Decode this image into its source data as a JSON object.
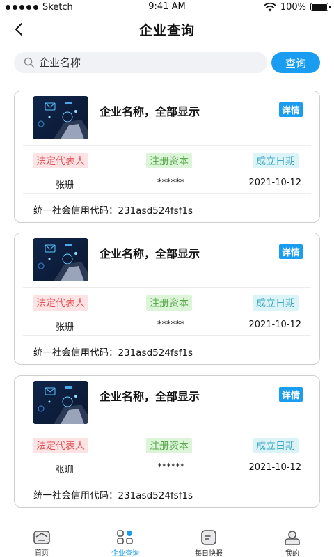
{
  "status_bar": {
    "carrier": "Sketch",
    "time": "9:41 AM",
    "battery": "100%"
  },
  "header": {
    "title": "企业查询"
  },
  "search": {
    "placeholder": "企业名称",
    "button_label": "查询"
  },
  "labels": {
    "legal_rep": "法定代表人",
    "capital": "注册资本",
    "founded": "成立日期",
    "credit_prefix": "统一社会信用代码：",
    "detail": "详情"
  },
  "companies": [
    {
      "name": "企业名称，全部显示",
      "legal_rep": "张珊",
      "capital": "******",
      "founded": "2021-10-12",
      "credit_code": "231asd524fsf1s"
    },
    {
      "name": "企业名称，全部显示",
      "legal_rep": "张珊",
      "capital": "******",
      "founded": "2021-10-12",
      "credit_code": "231asd524fsf1s"
    },
    {
      "name": "企业名称，全部显示",
      "legal_rep": "张珊",
      "capital": "******",
      "founded": "2021-10-12",
      "credit_code": "231asd524fsf1s"
    }
  ],
  "tabs": [
    {
      "label": "首页",
      "icon": "home-icon"
    },
    {
      "label": "企业查询",
      "icon": "grid-icon",
      "active": true
    },
    {
      "label": "每日快报",
      "icon": "news-icon"
    },
    {
      "label": "我的",
      "icon": "user-icon"
    }
  ],
  "colors": {
    "accent": "#1a9cf0",
    "legal_tag_bg": "#fde3e3",
    "capital_tag_bg": "#dcf5d8",
    "date_tag_bg": "#dcf3f7"
  }
}
